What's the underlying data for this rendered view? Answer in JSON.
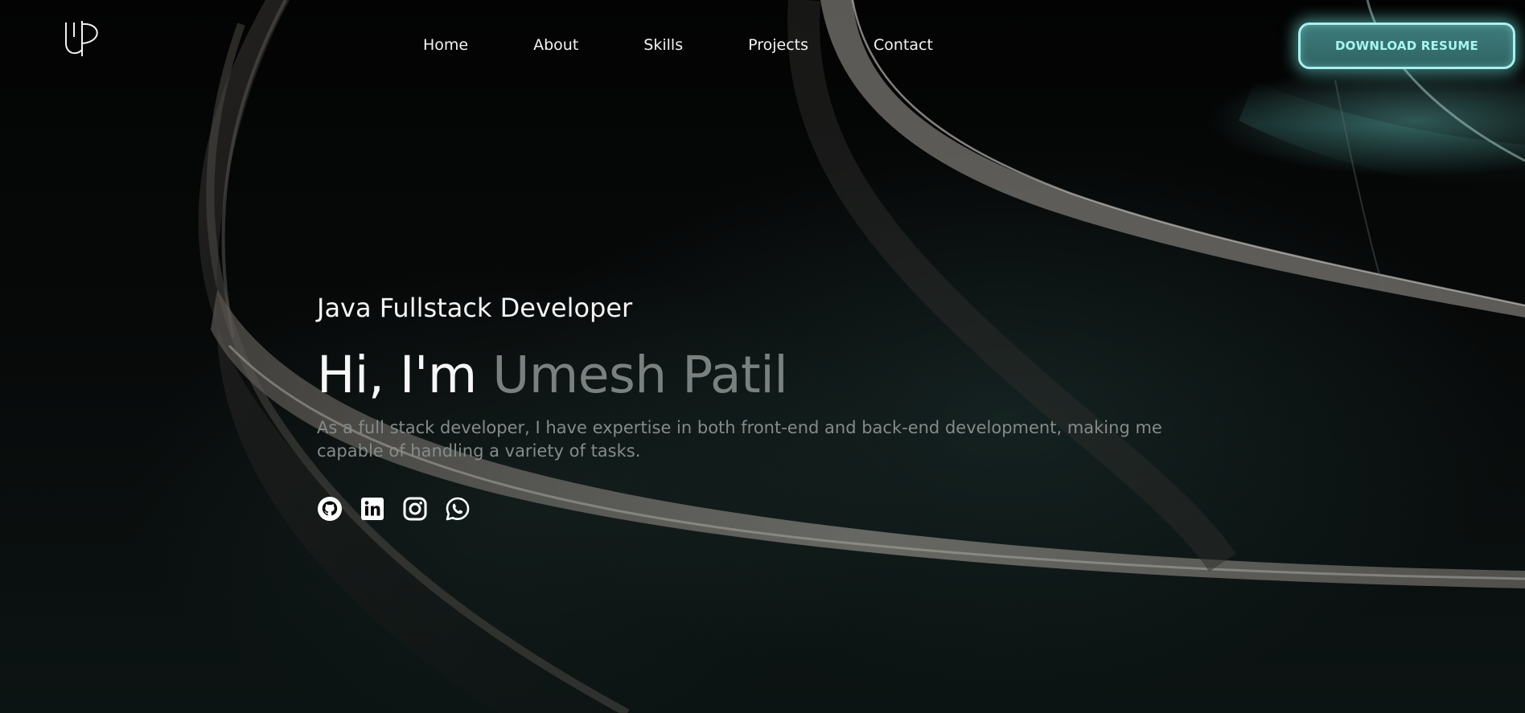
{
  "nav": {
    "logo_icon": "up-monogram-logo-icon",
    "items": [
      {
        "label": "Home"
      },
      {
        "label": "About"
      },
      {
        "label": "Skills"
      },
      {
        "label": "Projects"
      },
      {
        "label": "Contact"
      }
    ],
    "resume_button_label": "DOWNLOAD RESUME"
  },
  "hero": {
    "role": "Java Fullstack Developer",
    "greeting": "Hi, I'm",
    "name": "Umesh Patil",
    "description": "As a full stack developer, I have expertise in both front-end and back-end development, making me capable of handling a variety of tasks."
  },
  "socials": [
    {
      "icon": "github-icon"
    },
    {
      "icon": "linkedin-icon"
    },
    {
      "icon": "instagram-icon"
    },
    {
      "icon": "whatsapp-icon"
    }
  ],
  "colors": {
    "accent": "#a8f0ee",
    "button_fill": "#3a7473",
    "name_gray": "#7a807e",
    "text_light": "#f4f6f5"
  }
}
